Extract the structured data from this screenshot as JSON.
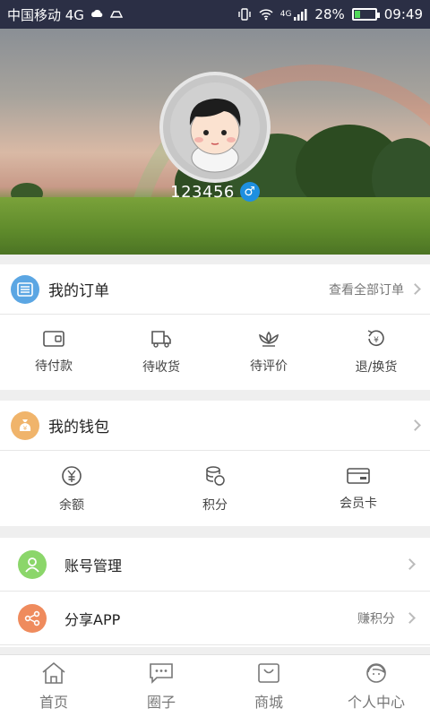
{
  "status_bar": {
    "carrier": "中国移动 4G",
    "battery_percent": "28%",
    "battery_level": 0.28,
    "signal_label": "4G",
    "time": "09:49"
  },
  "profile": {
    "username": "123456",
    "gender_symbol": "♂"
  },
  "orders": {
    "title": "我的订单",
    "view_all": "查看全部订单",
    "items": [
      {
        "label": "待付款",
        "icon": "wallet-icon"
      },
      {
        "label": "待收货",
        "icon": "truck-icon"
      },
      {
        "label": "待评价",
        "icon": "lotus-icon"
      },
      {
        "label": "退/换货",
        "icon": "refund-icon"
      }
    ]
  },
  "wallet": {
    "title": "我的钱包",
    "items": [
      {
        "label": "余额",
        "icon": "yen-icon"
      },
      {
        "label": "积分",
        "icon": "coins-icon"
      },
      {
        "label": "会员卡",
        "icon": "card-icon"
      }
    ]
  },
  "menu": [
    {
      "label": "账号管理",
      "extra": "",
      "icon": "account-icon"
    },
    {
      "label": "分享APP",
      "extra": "赚积分",
      "icon": "share-icon"
    }
  ],
  "tabbar": [
    {
      "label": "首页",
      "icon": "home-icon"
    },
    {
      "label": "圈子",
      "icon": "chat-icon"
    },
    {
      "label": "商城",
      "icon": "shop-icon"
    },
    {
      "label": "个人中心",
      "icon": "profile-icon"
    }
  ],
  "colors": {
    "status_bg": "#2b2f45",
    "order_icon_bg": "#5ba6e3",
    "wallet_icon_bg": "#f0b46b",
    "account_icon_bg": "#8bd66a",
    "share_icon_bg": "#ef8b5d",
    "gender_bg": "#1e8fe0"
  }
}
